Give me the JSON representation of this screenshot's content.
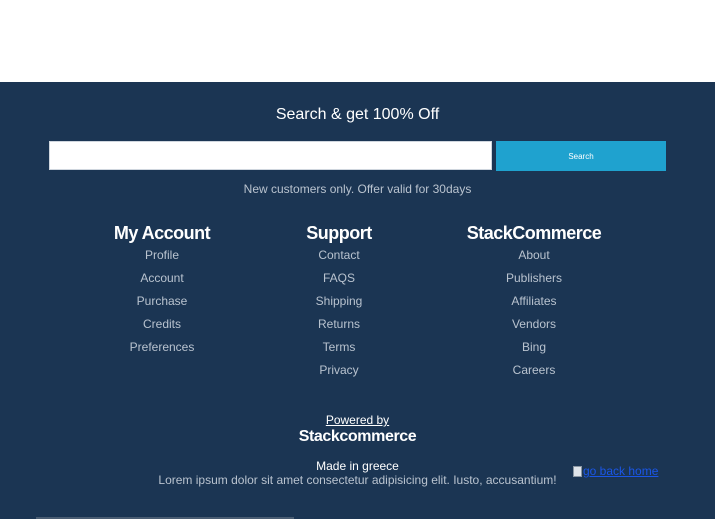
{
  "search": {
    "title": "Search & get 100% Off",
    "input_value": "",
    "placeholder": "",
    "button_label": "Search",
    "note": "New customers only. Offer valid for 30days"
  },
  "columns": {
    "account": {
      "heading": "My Account",
      "items": [
        "Profile",
        "Account",
        "Purchase",
        "Credits",
        "Preferences"
      ]
    },
    "support": {
      "heading": "Support",
      "items": [
        "Contact",
        "FAQS",
        "Shipping",
        "Returns",
        "Terms",
        "Privacy"
      ]
    },
    "stack": {
      "heading": "StackCommerce",
      "items": [
        "About",
        "Publishers",
        "Affiliates",
        "Vendors",
        "Bing",
        "Careers"
      ]
    }
  },
  "footer": {
    "powered_by": "Powered by",
    "brand": "Stackcommerce",
    "made_in": "Made in greece",
    "lorem": "Lorem ipsum dolor sit amet consectetur adipisicing elit. Iusto, accusantium!",
    "go_back_alt": "go back home",
    "go_back_icon": "broken-image-icon"
  },
  "colors": {
    "footer_bg": "#1b3553",
    "search_button": "#1fa2cf",
    "muted_text": "#b9c3cf",
    "link_blue": "#1a56e8"
  }
}
